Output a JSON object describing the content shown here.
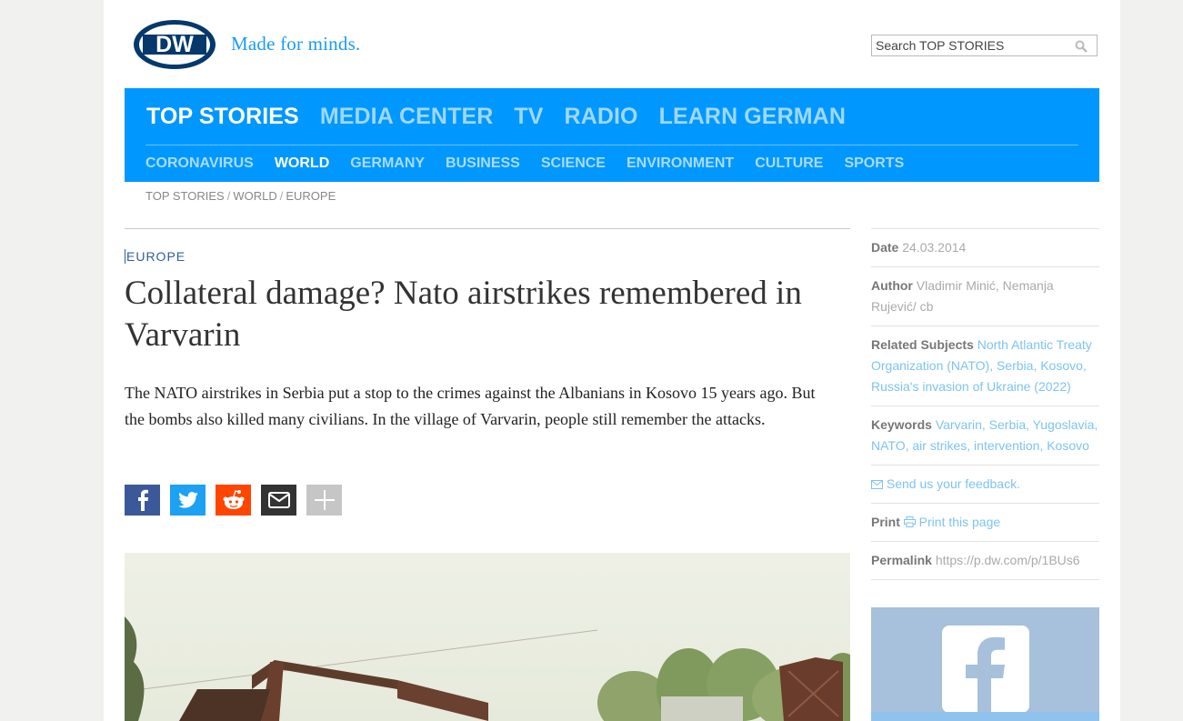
{
  "header": {
    "logo_alt": "DW",
    "tagline": "Made for minds.",
    "search_placeholder": "Search TOP STORIES"
  },
  "nav": {
    "main": [
      {
        "label": "TOP STORIES",
        "active": true
      },
      {
        "label": "MEDIA CENTER",
        "active": false
      },
      {
        "label": "TV",
        "active": false
      },
      {
        "label": "RADIO",
        "active": false
      },
      {
        "label": "LEARN GERMAN",
        "active": false
      }
    ],
    "sub": [
      {
        "label": "CORONAVIRUS",
        "active": false
      },
      {
        "label": "WORLD",
        "active": true
      },
      {
        "label": "GERMANY",
        "active": false
      },
      {
        "label": "BUSINESS",
        "active": false
      },
      {
        "label": "SCIENCE",
        "active": false
      },
      {
        "label": "ENVIRONMENT",
        "active": false
      },
      {
        "label": "CULTURE",
        "active": false
      },
      {
        "label": "SPORTS",
        "active": false
      }
    ]
  },
  "breadcrumb": [
    "TOP STORIES",
    "WORLD",
    "EUROPE"
  ],
  "article": {
    "kicker": "EUROPE",
    "headline": "Collateral damage? Nato airstrikes remembered in Varvarin",
    "teaser": "The NATO airstrikes in Serbia put a stop to the crimes against the Albanians in Kosovo 15 years ago. But the bombs also killed many civilians. In the village of Varvarin, people still remember the attacks.",
    "share": [
      "facebook-icon",
      "twitter-icon",
      "reddit-icon",
      "email-icon",
      "plus-icon"
    ]
  },
  "sidebar": {
    "date_label": "Date",
    "date_value": "24.03.2014",
    "author_label": "Author",
    "author_value": "Vladimir Minić, Nemanja Rujević/ cb",
    "related_label": "Related Subjects",
    "related_links": "North Atlantic Treaty Organization (NATO), Serbia, Kosovo, Russia's invasion of Ukraine (2022)",
    "keywords_label": "Keywords",
    "keywords_links": "Varvarin, Serbia, Yugoslavia, NATO, air strikes, intervention, Kosovo",
    "feedback_link": "Send us your feedback.",
    "print_label": "Print",
    "print_link": "Print this page",
    "permalink_label": "Permalink",
    "permalink_value": "https://p.dw.com/p/1BUs6"
  },
  "colors": {
    "brand_blue": "#0097ff",
    "link_blue": "#7ec3f3",
    "kicker_blue": "#2f5f9c",
    "facebook": "#3b5998",
    "twitter": "#1da1f2",
    "reddit": "#ff4500",
    "email": "#333333",
    "more": "#c6c6c6"
  }
}
